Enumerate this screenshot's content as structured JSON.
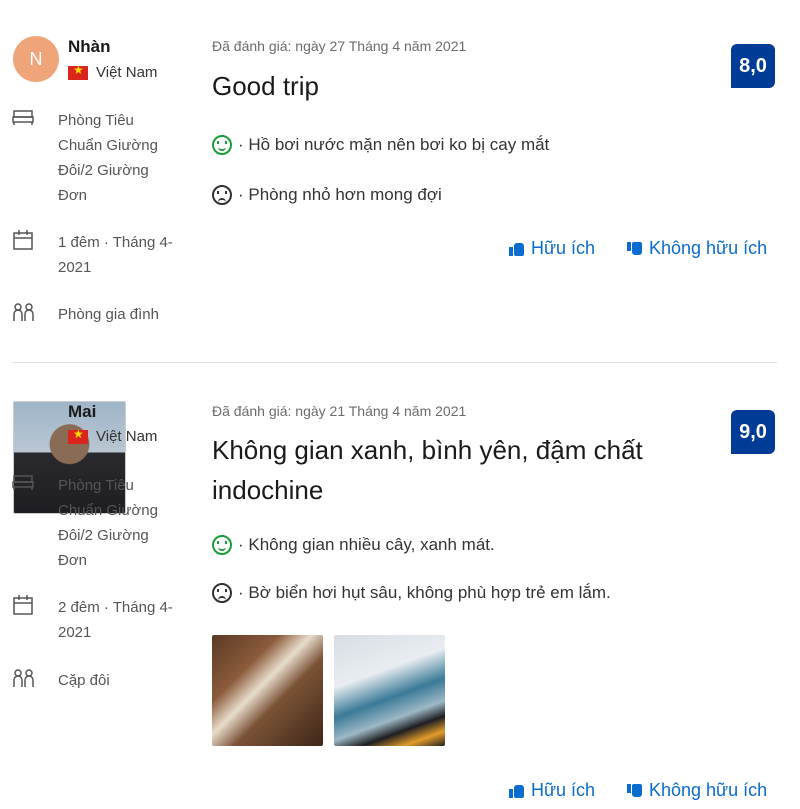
{
  "reviews": [
    {
      "avatar_letter": "N",
      "name": "Nhàn",
      "country": "Việt Nam",
      "room": "Phòng Tiêu Chuẩn Giường Đôi/2 Giường Đơn",
      "stay": "1 đêm · Tháng 4-2021",
      "traveler": "Phòng gia đình",
      "date": "Đã đánh giá: ngày 27 Tháng 4 năm 2021",
      "title": "Good trip",
      "positive": "· Hồ bơi nước mặn nên bơi ko bị cay mắt",
      "negative": "· Phòng nhỏ hơn mong đợi",
      "score": "8,0",
      "helpful": "Hữu ích",
      "not_helpful": "Không hữu ích"
    },
    {
      "name": "Mai",
      "country": "Việt Nam",
      "room": "Phòng Tiêu Chuẩn Giường Đôi/2 Giường Đơn",
      "stay": "2 đêm · Tháng 4-2021",
      "traveler": "Cặp đôi",
      "date": "Đã đánh giá: ngày 21 Tháng 4 năm 2021",
      "title": "Không gian xanh, bình yên, đậm chất indochine",
      "positive": "· Không gian nhiều cây, xanh mát.",
      "negative": "· Bờ biển hơi hụt sâu, không phù hợp trẻ em lắm.",
      "score": "9,0",
      "helpful": "Hữu ích",
      "not_helpful": "Không hữu ích"
    }
  ],
  "colors": {
    "score_bg": "#003b95",
    "link": "#0a6ccf",
    "positive": "#1b9e3c"
  },
  "icons": [
    "bed-icon",
    "calendar-icon",
    "people-icon",
    "smile-icon",
    "sad-icon",
    "thumbs-up-icon",
    "thumbs-down-icon"
  ]
}
